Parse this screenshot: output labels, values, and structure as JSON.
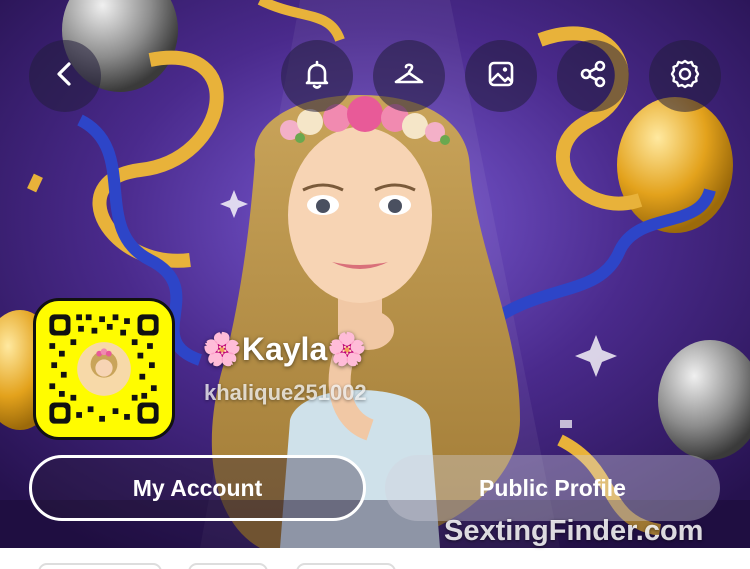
{
  "topbar": {
    "buttons": [
      {
        "name": "back",
        "icon": "chevron-left-icon"
      },
      {
        "name": "notifications",
        "icon": "bell-icon"
      },
      {
        "name": "outfit",
        "icon": "hanger-icon"
      },
      {
        "name": "background",
        "icon": "image-icon"
      },
      {
        "name": "share",
        "icon": "share-icon"
      },
      {
        "name": "settings",
        "icon": "gear-icon"
      }
    ]
  },
  "profile": {
    "display_name": "🌸Kayla🌸",
    "username": "khalique251002"
  },
  "actions": {
    "my_account_label": "My Account",
    "public_profile_label": "Public Profile"
  },
  "watermark": "SextingFinder.com",
  "colors": {
    "snapcode_yellow": "#FFFC00",
    "bg_purple": "#4a2a8c",
    "ribbon_gold": "#e8b23a",
    "ribbon_blue": "#2d45c8"
  }
}
